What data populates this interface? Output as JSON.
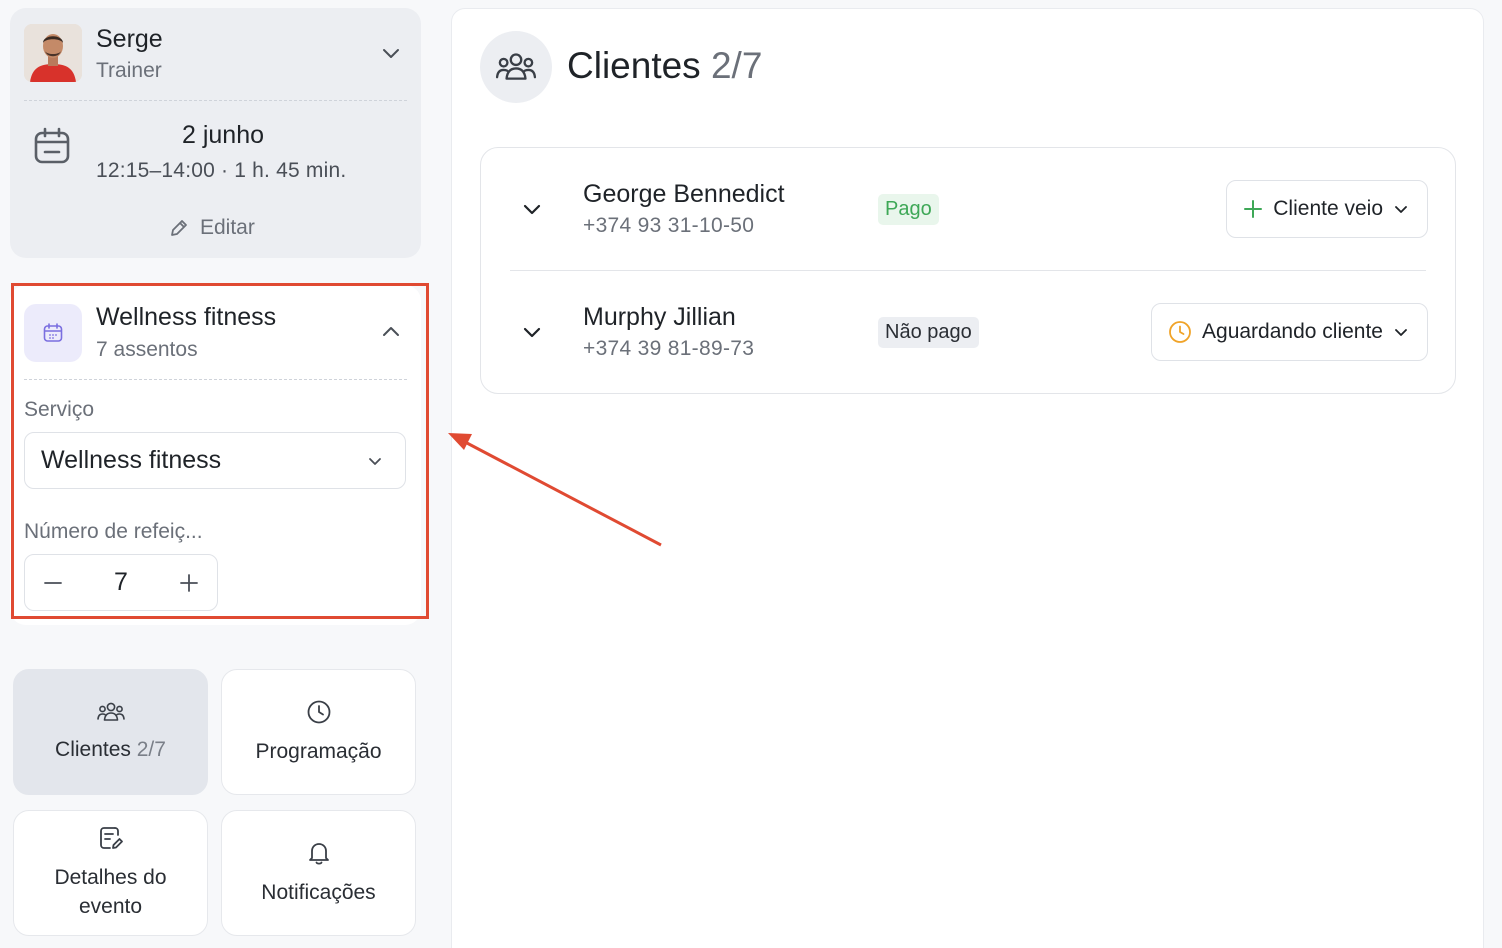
{
  "trainer": {
    "name": "Serge",
    "role": "Trainer"
  },
  "event": {
    "date": "2 junho",
    "time": "12:15–14:00 · 1 h. 45 min.",
    "edit_label": "Editar"
  },
  "service": {
    "name": "Wellness fitness",
    "seats": "7 assentos",
    "service_label": "Serviço",
    "selected_service": "Wellness fitness",
    "meals_label": "Número de refeiç...",
    "meals_value": "7"
  },
  "nav_tiles": [
    {
      "label": "Clientes",
      "count": "2/7",
      "icon": "people-icon"
    },
    {
      "label": "Programação",
      "icon": "clock-icon"
    },
    {
      "label": "Detalhes do evento",
      "icon": "edit-document-icon"
    },
    {
      "label": "Notificações",
      "icon": "bell-icon"
    }
  ],
  "main": {
    "title": "Clientes",
    "count": "2/7",
    "clients": [
      {
        "name": "George Bennedict",
        "phone": "+374 93 31-10-50",
        "payment": "Pago",
        "status": "Cliente veio",
        "status_icon": "plus-icon"
      },
      {
        "name": "Murphy Jillian",
        "phone": "+374 39 81-89-73",
        "payment": "Não pago",
        "status": "Aguardando cliente",
        "status_icon": "clock-icon"
      }
    ]
  },
  "colors": {
    "highlight": "#e04a32",
    "paid_text": "#3ea857",
    "paid_bg": "#e9f6ec",
    "waiting_icon": "#f0a328",
    "service_icon": "#7a6ee0"
  }
}
